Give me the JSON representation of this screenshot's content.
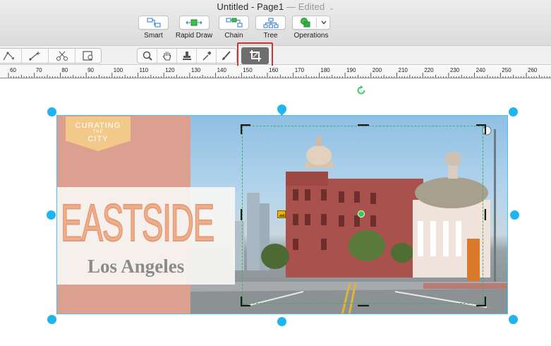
{
  "window": {
    "title": "Untitled - Page1",
    "edited": "— Edited"
  },
  "toolbar": {
    "smart": "Smart",
    "rapid_draw": "Rapid Draw",
    "chain": "Chain",
    "tree": "Tree",
    "operations": "Operations"
  },
  "tools": {
    "left_group": [
      "connector-tool-icon",
      "line-tool-icon",
      "scissor-tool-icon",
      "image-tool-icon"
    ],
    "right_group": [
      "zoom-tool-icon",
      "hand-tool-icon",
      "stamp-tool-icon",
      "eyedropper-tool-icon",
      "paintbrush-tool-icon"
    ],
    "active": "crop-tool"
  },
  "zoom": {
    "level": 0.27
  },
  "ruler": {
    "labels": [
      "60",
      "70",
      "80",
      "90",
      "100",
      "110",
      "120",
      "130",
      "140",
      "150",
      "160",
      "170",
      "180",
      "190",
      "200",
      "210",
      "220",
      "230",
      "240",
      "250",
      "260"
    ]
  },
  "image": {
    "stamp_line1": "CURATING",
    "stamp_line2": "THE",
    "stamp_line3": "CITY",
    "headline": "EASTSIDE",
    "subline": "Los Angeles"
  },
  "colors": {
    "selection": "#1fb6f0",
    "crop_highlight": "#c9353d",
    "crop_frame": "#3fae64",
    "salmon_panel": "#dba08f"
  }
}
